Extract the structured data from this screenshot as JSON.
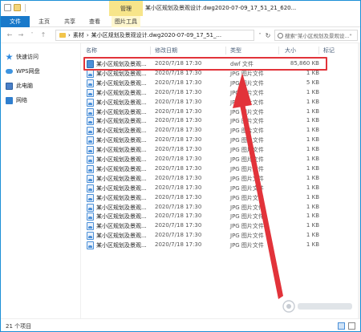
{
  "titlebar": {
    "manage_tab": "管理",
    "title": "某小区规划及景观设计.dwg2020-07-09_17_51_21_620..."
  },
  "ribbon": {
    "tabs": [
      "文件",
      "主页",
      "共享",
      "查看",
      "图片工具"
    ]
  },
  "address": {
    "path": [
      "素材",
      "某小区规划及景观设计.dwg2020-07-09_17_51_..."
    ],
    "search_placeholder": "搜索\"某小区规划及景观设...\""
  },
  "nav": {
    "items": [
      "快速访问",
      "WPS网盘",
      "此电脑",
      "网络"
    ]
  },
  "columns": {
    "name": "名称",
    "date": "修改日期",
    "type": "类型",
    "size": "大小",
    "tags": "标记"
  },
  "files": [
    {
      "name": "某小区规划及景观...",
      "date": "2020/7/18 17:30",
      "type": "dwf 文件",
      "size": "85,860 KB"
    },
    {
      "name": "某小区规划及景观...",
      "date": "2020/7/18 17:30",
      "type": "JPG 图片文件",
      "size": "1 KB"
    },
    {
      "name": "某小区规划及景观...",
      "date": "2020/7/18 17:30",
      "type": "JPG 图片文件",
      "size": "5 KB"
    },
    {
      "name": "某小区规划及景观...",
      "date": "2020/7/18 17:30",
      "type": "JPG 图片文件",
      "size": "1 KB"
    },
    {
      "name": "某小区规划及景观...",
      "date": "2020/7/18 17:30",
      "type": "JPG 图片文件",
      "size": "1 KB"
    },
    {
      "name": "某小区规划及景观...",
      "date": "2020/7/18 17:30",
      "type": "JPG 图片文件",
      "size": "1 KB"
    },
    {
      "name": "某小区规划及景观...",
      "date": "2020/7/18 17:30",
      "type": "JPG 图片文件",
      "size": "1 KB"
    },
    {
      "name": "某小区规划及景观...",
      "date": "2020/7/18 17:30",
      "type": "JPG 图片文件",
      "size": "1 KB"
    },
    {
      "name": "某小区规划及景观...",
      "date": "2020/7/18 17:30",
      "type": "JPG 图片文件",
      "size": "1 KB"
    },
    {
      "name": "某小区规划及景观...",
      "date": "2020/7/18 17:30",
      "type": "JPG 图片文件",
      "size": "1 KB"
    },
    {
      "name": "某小区规划及景观...",
      "date": "2020/7/18 17:30",
      "type": "JPG 图片文件",
      "size": "1 KB"
    },
    {
      "name": "某小区规划及景观...",
      "date": "2020/7/18 17:30",
      "type": "JPG 图片文件",
      "size": "1 KB"
    },
    {
      "name": "某小区规划及景观...",
      "date": "2020/7/18 17:30",
      "type": "JPG 图片文件",
      "size": "1 KB"
    },
    {
      "name": "某小区规划及景观...",
      "date": "2020/7/18 17:30",
      "type": "JPG 图片文件",
      "size": "1 KB"
    },
    {
      "name": "某小区规划及景观...",
      "date": "2020/7/18 17:30",
      "type": "JPG 图片文件",
      "size": "1 KB"
    },
    {
      "name": "某小区规划及景观...",
      "date": "2020/7/18 17:30",
      "type": "JPG 图片文件",
      "size": "1 KB"
    },
    {
      "name": "某小区规划及景观...",
      "date": "2020/7/18 17:30",
      "type": "JPG 图片文件",
      "size": "1 KB"
    },
    {
      "name": "某小区规划及景观...",
      "date": "2020/7/18 17:30",
      "type": "JPG 图片文件",
      "size": "1 KB"
    },
    {
      "name": "某小区规划及景观...",
      "date": "2020/7/18 17:30",
      "type": "JPG 图片文件",
      "size": "1 KB"
    },
    {
      "name": "某小区规划及景观...",
      "date": "2020/7/18 17:30",
      "type": "JPG 图片文件",
      "size": "1 KB"
    }
  ],
  "status": {
    "count_text": "21 个项目"
  },
  "colors": {
    "accent": "#1979ca",
    "manage_tab": "#f7e58a",
    "highlight": "#e2333a"
  }
}
